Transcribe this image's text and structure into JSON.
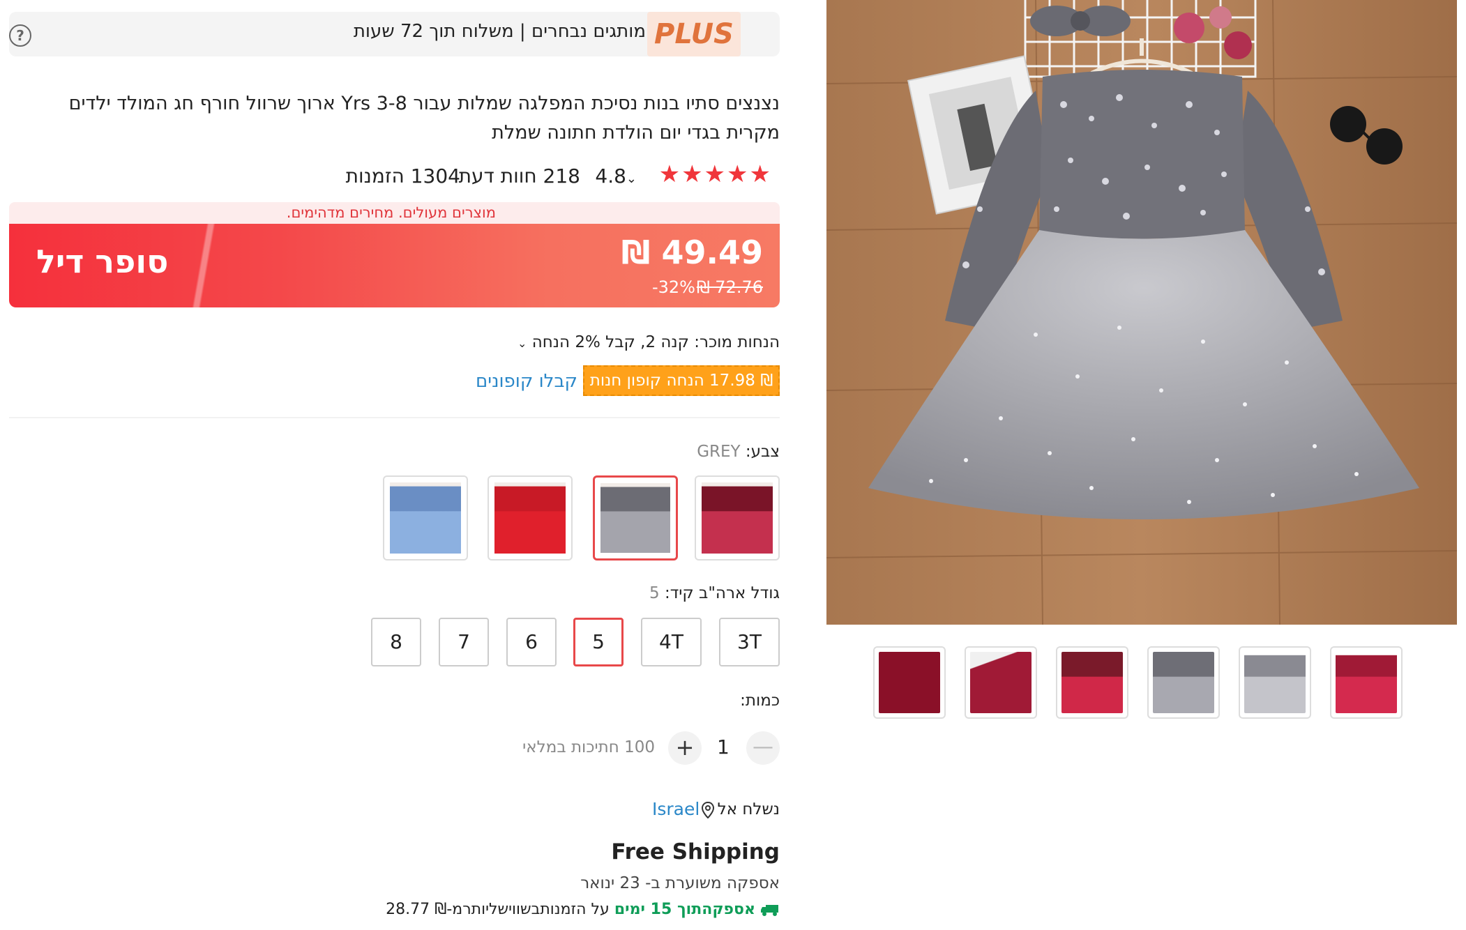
{
  "plus": {
    "logo": "PLUS",
    "text": "מותגים נבחרים | משלוח תוך 72 שעות"
  },
  "product": {
    "title": "נצנצים סתיו בנות נסיכת המפלגה שמלות עבור Yrs 3-8 ארוך שרוול חורף חג המולד ילדים מקרית בגדי יום הולדת חתונה שמלת",
    "rating": "4.8",
    "reviews": "218 חוות דעת",
    "orders": "1304 הזמנות"
  },
  "promo": {
    "strip_text": "מוצרים מעולים. מחירים מדהימים."
  },
  "deal": {
    "label": "סופר דיל",
    "price": "₪ 49.49",
    "old_price": "₪ 72.76",
    "discount": "-32%"
  },
  "seller": {
    "discounts": "הנחות מוכר: קנה 2, קבל 2% הנחה",
    "coupon": "₪ 17.98 הנחה קופון חנות",
    "get_coupons": "קבלו קופונים"
  },
  "color": {
    "label": "צבע: ",
    "value": "GREY",
    "colors": [
      "#c43a5a",
      "#8e8f99",
      "#d6202c",
      "#7aa0d0"
    ]
  },
  "size": {
    "label": "גודל ארה\"ב קיד: ",
    "value": "5",
    "options": [
      "3T",
      "4T",
      "5",
      "6",
      "7",
      "8"
    ],
    "selected": "5"
  },
  "quantity": {
    "label": "כמות:",
    "value": "1",
    "minus": "—",
    "plus": "+",
    "available": "100 חתיכות במלאי"
  },
  "shipping": {
    "ship_to_label": "נשלח אל",
    "country": "Israel",
    "free": "Free Shipping",
    "estimate": "אספקה משוערת ב- 23 ינואר",
    "fast_prefix": "אספקהתוך 15 ימים",
    "fast_suffix": " על הזמנותבשווישליותרמ-₪ 28.77"
  },
  "gallery": {
    "thumb_colors": [
      "#c41e3a",
      "#a8a8b0",
      "#8a8c96",
      "#c23050",
      "#b81e40",
      "#6e1020"
    ]
  },
  "icons": {
    "help": "question-icon",
    "pin": "location-pin-icon",
    "truck": "truck-icon",
    "chevron": "chevron-down-icon"
  }
}
